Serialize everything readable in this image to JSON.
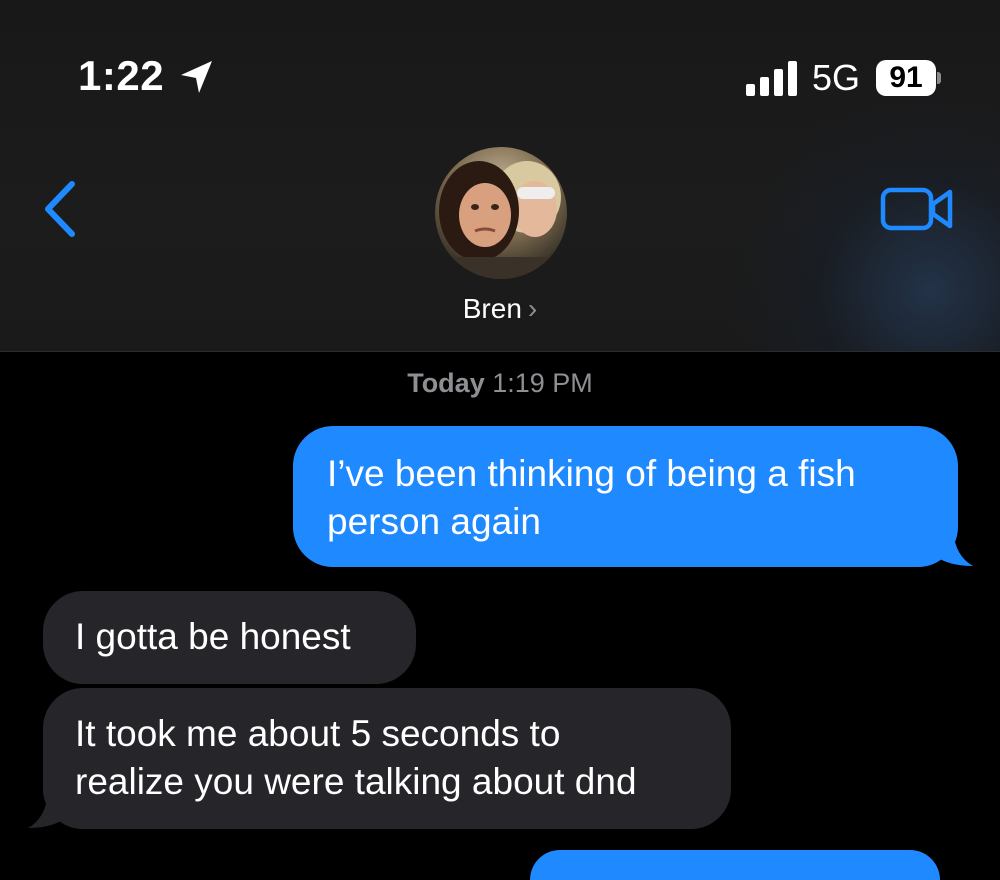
{
  "status_bar": {
    "time": "1:22",
    "network": "5G",
    "battery": "91"
  },
  "nav": {
    "contact_name": "Bren",
    "chevron": "›"
  },
  "conversation": {
    "timestamp_day": "Today",
    "timestamp_time": "1:19 PM",
    "messages": [
      {
        "sender": "me",
        "lines": [
          "I’ve been thinking of being a fish",
          "person again"
        ]
      },
      {
        "sender": "them",
        "lines": [
          "I gotta be honest"
        ]
      },
      {
        "sender": "them",
        "lines": [
          "It took me about 5 seconds to",
          "realize you were talking about dnd"
        ]
      }
    ]
  },
  "colors": {
    "accent": "#1f8aff",
    "received_bubble": "#26252a",
    "background": "#000000"
  },
  "icons": [
    "location-arrow-icon",
    "signal-bars-icon",
    "battery-icon",
    "back-chevron-icon",
    "video-camera-icon"
  ]
}
